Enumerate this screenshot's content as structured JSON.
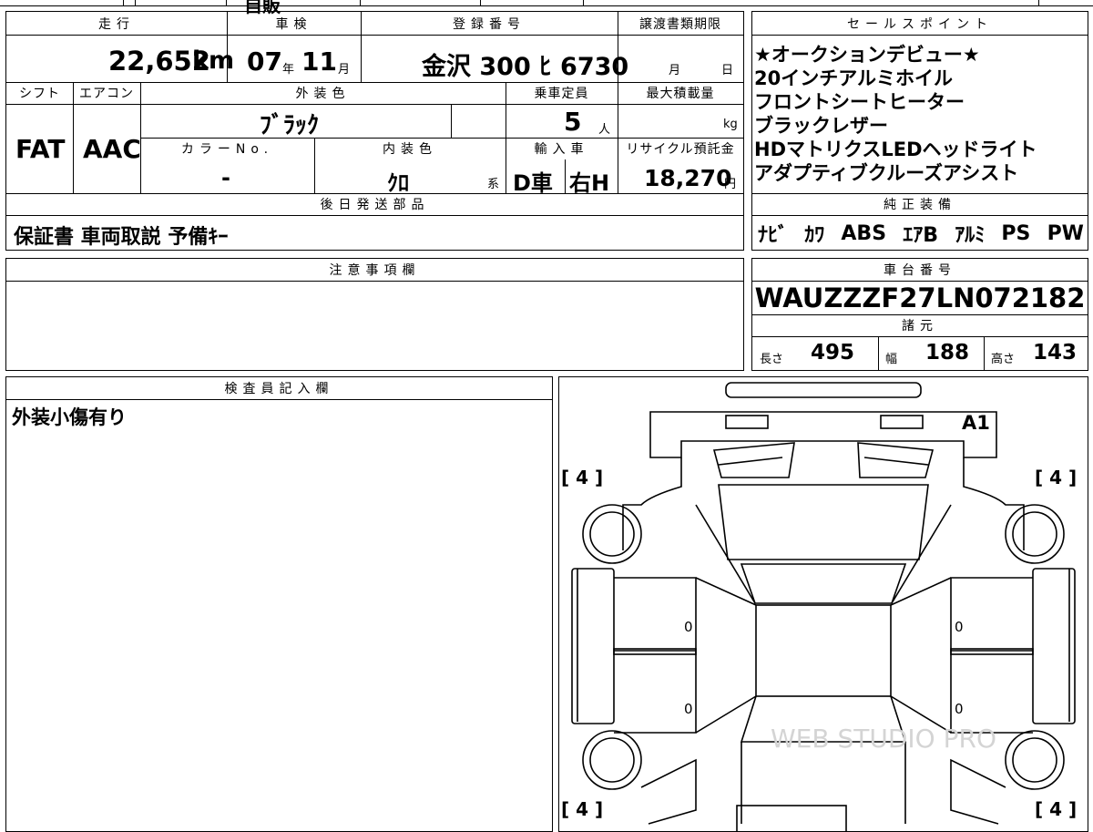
{
  "top_fragment": "自販",
  "headers": {
    "mileage": "走行",
    "inspection": "車検",
    "registration": "登録番号",
    "transfer_deadline": "譲渡書類期限",
    "sales_points": "セールスポイント",
    "shift": "シフト",
    "aircon": "エアコン",
    "exterior_color": "外装色",
    "capacity": "乗車定員",
    "max_load": "最大積載量",
    "color_no": "カラーNo.",
    "interior_color": "内装色",
    "import": "輸入車",
    "recycle": "リサイクル預託金",
    "deferred_parts": "後日発送部品",
    "factory_equipment": "純正装備",
    "notes": "注意事項欄",
    "chassis_no": "車台番号",
    "specs": "諸元",
    "inspector_notes": "検査員記入欄"
  },
  "vehicle": {
    "mileage_value": "22,652",
    "mileage_unit": "km",
    "inspection_year": "07",
    "inspection_year_unit": "年",
    "inspection_month": "11",
    "inspection_month_unit": "月",
    "plate": "金沢 300 ﾋ 6730",
    "deadline_month_unit": "月",
    "deadline_day_unit": "日",
    "shift": "FAT",
    "aircon": "AAC",
    "exterior_color": "ﾌﾞﾗｯｸ",
    "capacity": "5",
    "capacity_unit": "人",
    "max_load_unit": "kg",
    "color_no": "-",
    "interior_color": "ｸﾛ",
    "interior_suffix": "系",
    "import_type": "D車",
    "steering": "右H",
    "recycle_fee": "18,270",
    "recycle_unit": "円",
    "chassis_no": "WAUZZZF27LN072182"
  },
  "sales_points": [
    "★オークションデビュー★",
    "20インチアルミホイル",
    "フロントシートヒーター",
    "ブラックレザー",
    "HDマトリクスLEDヘッドライト",
    "アダプティブクルーズアシスト"
  ],
  "deferred_parts_text": "保証書 車両取説 予備ｷｰ",
  "equipment_items": [
    "ﾅﾋﾞ",
    "ｶﾜ",
    "ABS",
    "ｴｱB",
    "ｱﾙﾐ",
    "PS",
    "PW"
  ],
  "specs": {
    "length_label": "長さ",
    "length_value": "495",
    "width_label": "幅",
    "width_value": "188",
    "height_label": "高さ",
    "height_value": "143"
  },
  "inspector_note": "外装小傷有り",
  "diagram": {
    "tread_front_left": "[ 4 ]",
    "tread_front_right": "[ 4 ]",
    "tread_rear_left": "[ 4 ]",
    "tread_rear_right": "[ 4 ]",
    "damage_code": "A1",
    "door_left_front": "0",
    "door_left_rear": "0",
    "door_right_front": "0",
    "door_right_rear": "0",
    "watermark": "WEB STUDIO PRO"
  }
}
